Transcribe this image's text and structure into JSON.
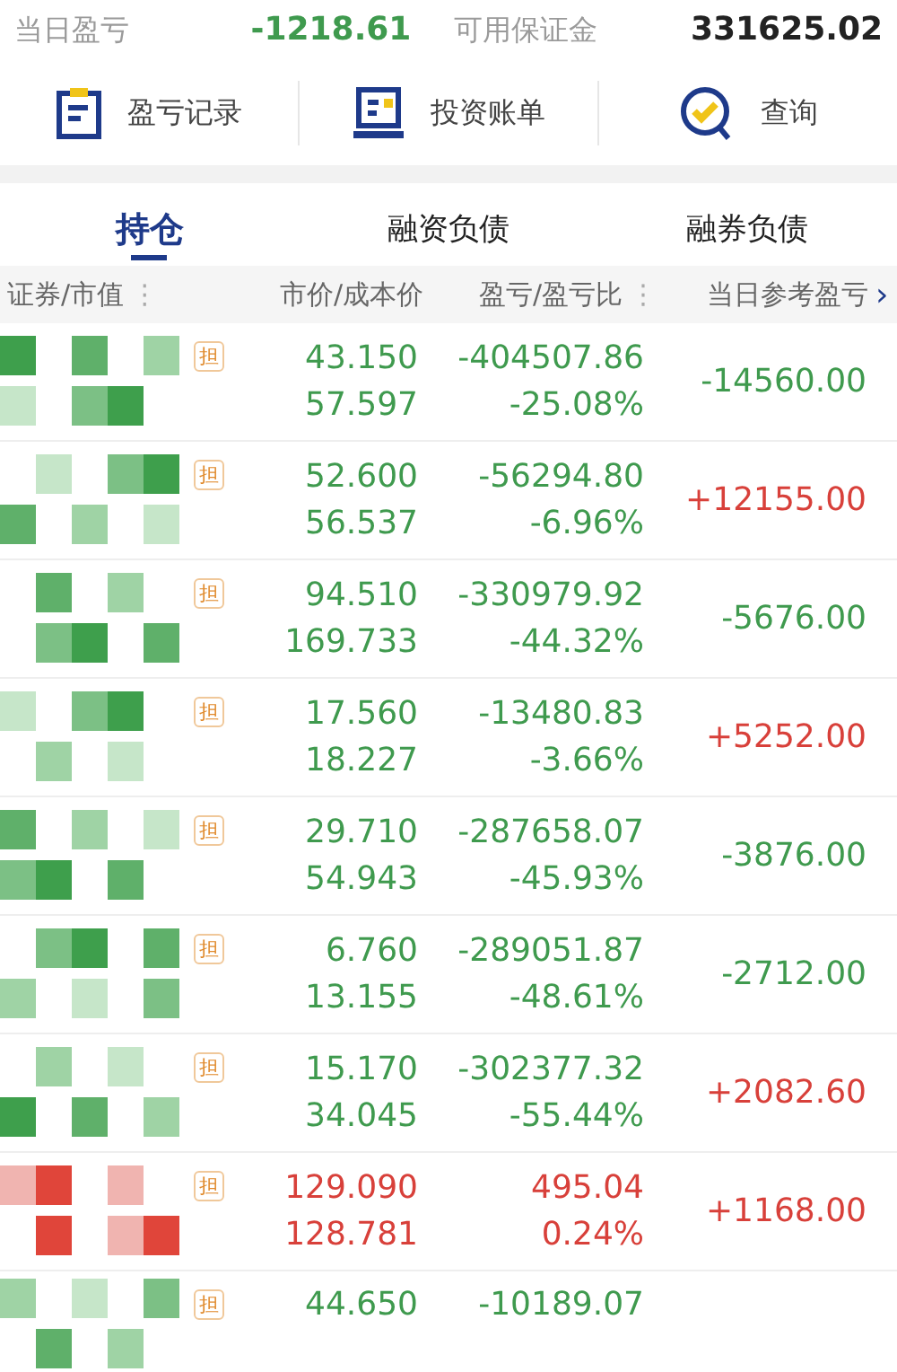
{
  "summary": {
    "label": "当日盈亏",
    "value": {
      "text": "-1218.61",
      "color": "#3f9a4e"
    },
    "label_2": "可用保证金",
    "value_2": "331625.02"
  },
  "actions": [
    {
      "label": "盈亏记录",
      "kind": "record"
    },
    {
      "label": "投资账单",
      "kind": "bill"
    },
    {
      "label": "查询",
      "kind": "query"
    }
  ],
  "tabs": [
    {
      "label": "持仓",
      "selected": true
    },
    {
      "label": "融资负债",
      "selected": false
    },
    {
      "label": "融券负债",
      "selected": false
    }
  ],
  "columns": [
    {
      "label": "证券/市值",
      "menu_icon": "⋮"
    },
    {
      "label": "市价/成本价"
    },
    {
      "label": "盈亏/盈亏比",
      "menu_icon": "⋮"
    },
    {
      "label": "当日参考盈亏"
    }
  ],
  "more_columns": "›",
  "rows": [
    {
      "badge": "担",
      "price": "43.150",
      "cost": "57.597",
      "pnl": "-404507.86",
      "ratio": "-25.08%",
      "color": "#3f9a4e",
      "daily": {
        "text": "-14560.00",
        "color": "#3f9a4e"
      }
    },
    {
      "badge": "担",
      "price": "52.600",
      "cost": "56.537",
      "pnl": "-56294.80",
      "ratio": "-6.96%",
      "color": "#3f9a4e",
      "daily": {
        "text": "+12155.00",
        "color": "#d8403a"
      }
    },
    {
      "badge": "担",
      "price": "94.510",
      "cost": "169.733",
      "pnl": "-330979.92",
      "ratio": "-44.32%",
      "color": "#3f9a4e",
      "daily": {
        "text": "-5676.00",
        "color": "#3f9a4e"
      }
    },
    {
      "badge": "担",
      "price": "17.560",
      "cost": "18.227",
      "pnl": "-13480.83",
      "ratio": "-3.66%",
      "color": "#3f9a4e",
      "daily": {
        "text": "+5252.00",
        "color": "#d8403a"
      }
    },
    {
      "badge": "担",
      "price": "29.710",
      "cost": "54.943",
      "pnl": "-287658.07",
      "ratio": "-45.93%",
      "color": "#3f9a4e",
      "daily": {
        "text": "-3876.00",
        "color": "#3f9a4e"
      }
    },
    {
      "badge": "担",
      "price": "6.760",
      "cost": "13.155",
      "pnl": "-289051.87",
      "ratio": "-48.61%",
      "color": "#3f9a4e",
      "daily": {
        "text": "-2712.00",
        "color": "#3f9a4e"
      }
    },
    {
      "badge": "担",
      "price": "15.170",
      "cost": "34.045",
      "pnl": "-302377.32",
      "ratio": "-55.44%",
      "color": "#3f9a4e",
      "daily": {
        "text": "+2082.60",
        "color": "#d8403a"
      }
    },
    {
      "badge": "担",
      "price": "129.090",
      "cost": "128.781",
      "pnl": "495.04",
      "ratio": "0.24%",
      "color": "#d8403a",
      "daily": {
        "text": "+1168.00",
        "color": "#d8403a"
      }
    },
    {
      "badge": "担",
      "price": "44.650",
      "pnl": "-10189.07",
      "color": "#3f9a4e"
    }
  ]
}
